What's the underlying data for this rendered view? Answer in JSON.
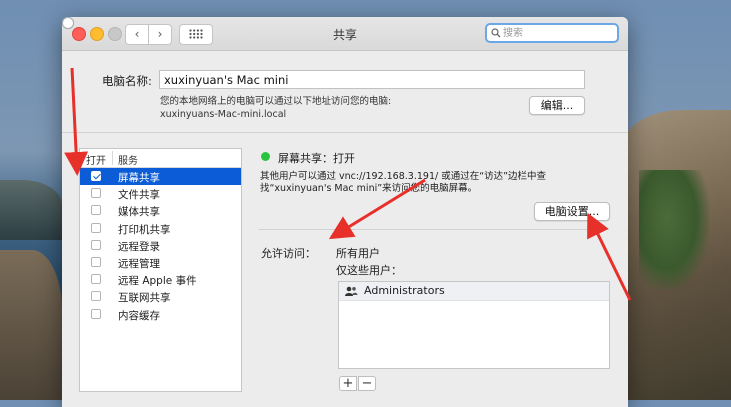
{
  "window": {
    "title": "共享",
    "search_placeholder": "搜索"
  },
  "computer_name": {
    "label": "电脑名称:",
    "value": "xuxinyuan's Mac mini",
    "desc_line1": "您的本地网络上的电脑可以通过以下地址访问您的电脑:",
    "desc_line2": "xuxinyuans-Mac-mini.local",
    "edit_button": "编辑..."
  },
  "services": {
    "header_open": "打开",
    "header_service": "服务",
    "items": [
      {
        "label": "屏幕共享",
        "checked": true,
        "selected": true
      },
      {
        "label": "文件共享",
        "checked": false,
        "selected": false
      },
      {
        "label": "媒体共享",
        "checked": false,
        "selected": false
      },
      {
        "label": "打印机共享",
        "checked": false,
        "selected": false
      },
      {
        "label": "远程登录",
        "checked": false,
        "selected": false
      },
      {
        "label": "远程管理",
        "checked": false,
        "selected": false
      },
      {
        "label": "远程 Apple 事件",
        "checked": false,
        "selected": false
      },
      {
        "label": "互联网共享",
        "checked": false,
        "selected": false
      },
      {
        "label": "内容缓存",
        "checked": false,
        "selected": false
      }
    ]
  },
  "detail": {
    "status": "屏幕共享：打开",
    "status_color": "#2ac33d",
    "description": "其他用户可以通过 vnc://192.168.3.191/ 或通过在“访达”边栏中查找“xuxinyuan's Mac mini”来访问您的电脑屏幕。",
    "settings_button": "电脑设置...",
    "access_label": "允许访问：",
    "option_all": "所有用户",
    "option_only": "仅这些用户：",
    "selected_option": "all",
    "users": [
      "Administrators"
    ],
    "add_button": "+",
    "remove_button": "−"
  },
  "colors": {
    "accent": "#0b5cd6",
    "annotation": "#e8302a"
  }
}
